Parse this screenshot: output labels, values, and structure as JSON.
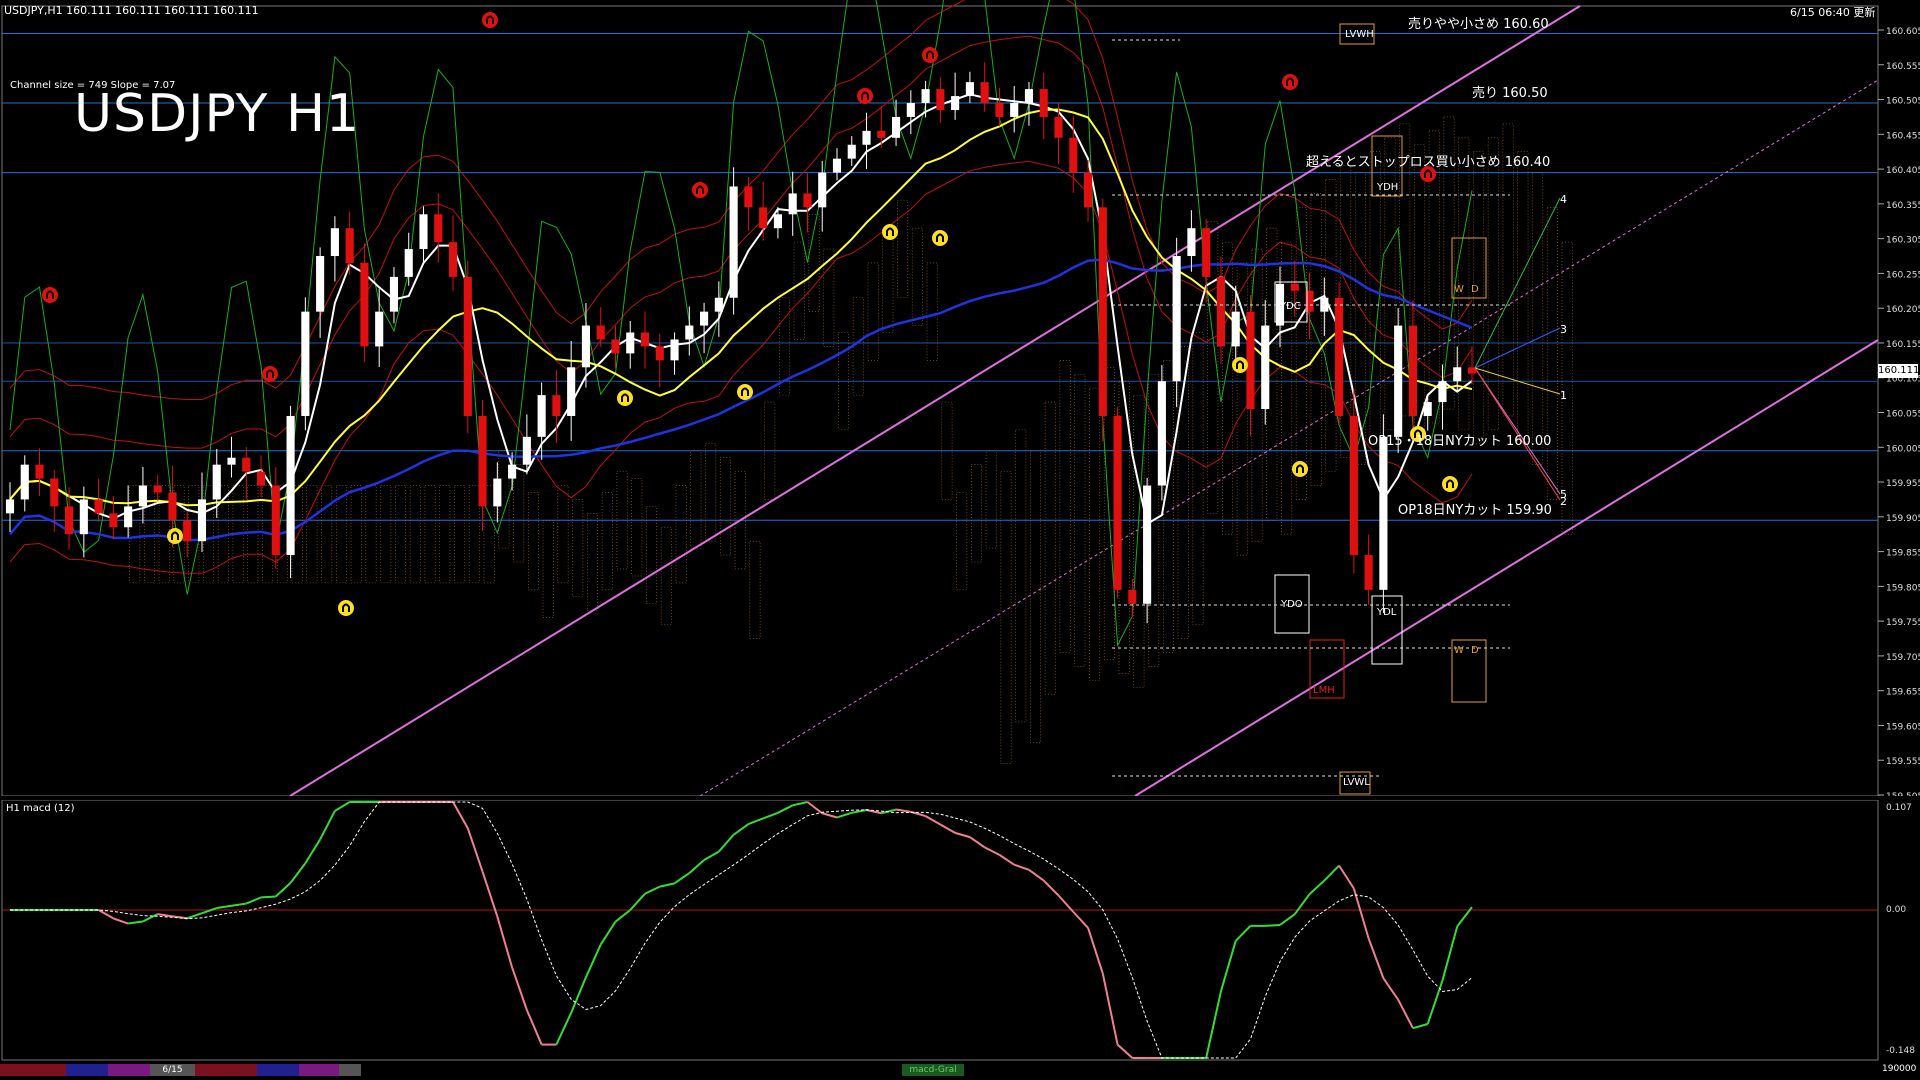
{
  "window": {
    "header_text": "USDJPY,H1  160.111 160.111 160.111 160.111",
    "timestamp": "6/15 06:40 更新"
  },
  "title": "USDJPY H1",
  "channel_info": "Channel size = 749 Slope = 7.07",
  "indicator_label": "H1  macd (12)",
  "current_price": "160.111",
  "price_axis": [
    "160.605",
    "160.555",
    "160.505",
    "160.455",
    "160.405",
    "160.355",
    "160.305",
    "160.255",
    "160.205",
    "160.155",
    "160.105",
    "160.055",
    "160.005",
    "159.955",
    "159.905",
    "159.855",
    "159.805",
    "159.755",
    "159.705",
    "159.655",
    "159.605",
    "159.555",
    "159.505"
  ],
  "macd_axis": [
    "0.107",
    "0.00",
    "-0.148"
  ],
  "levels": [
    {
      "label": "売りやや小さめ 160.60",
      "price": 160.6
    },
    {
      "label": "売り 160.50",
      "price": 160.5
    },
    {
      "label": "超えるとストップロス買い小さめ 160.40",
      "price": 160.4
    },
    {
      "label": "OP15・18日NYカット 160.00",
      "price": 160.0
    },
    {
      "label": "OP18日NYカット 159.90",
      "price": 159.9
    }
  ],
  "box_labels": {
    "lvwh": "LVWH",
    "ydh": "YDH",
    "ydc": "YDC",
    "ydo": "YDO",
    "ydl": "YDL",
    "lmh": "LMH",
    "lvwl": "LVWL",
    "w": "W",
    "d": "D",
    "w2": "W",
    "d2": "D"
  },
  "projection_labels": [
    "4",
    "3",
    "1",
    "5",
    "2"
  ],
  "bottom_tab_date": "6/15",
  "bottom_right": "190000",
  "bottom_center": "macd-Gral",
  "colors": {
    "level_line": "#1e6fd9",
    "channel": "#e070e0",
    "ichimoku_cloud_up": "#c8783c",
    "ichimoku_cloud_down": "#2438c8",
    "ma_short": "#ffffff",
    "ma_mid": "#ffff33",
    "ma_long": "#2033e0",
    "bollinger": "#c01010",
    "green_line": "#18b018",
    "candle_up": "#ffffff",
    "candle_down": "#e01010",
    "macd_up": "#33dd33",
    "macd_down": "#f08090",
    "signal": "#ffffff"
  },
  "chart_data": {
    "type": "candlestick",
    "symbol": "USDJPY",
    "timeframe": "H1",
    "ylim": [
      159.505,
      160.605
    ],
    "candle_count": 100,
    "close_path": [
      159.93,
      159.98,
      159.96,
      159.92,
      159.88,
      159.93,
      159.91,
      159.89,
      159.92,
      159.95,
      159.94,
      159.9,
      159.87,
      159.93,
      159.98,
      159.99,
      159.97,
      159.95,
      159.85,
      160.05,
      160.2,
      160.28,
      160.32,
      160.27,
      160.15,
      160.2,
      160.25,
      160.29,
      160.34,
      160.3,
      160.25,
      160.05,
      159.92,
      159.96,
      159.98,
      160.02,
      160.08,
      160.05,
      160.12,
      160.18,
      160.16,
      160.14,
      160.17,
      160.15,
      160.13,
      160.16,
      160.18,
      160.2,
      160.22,
      160.38,
      160.35,
      160.32,
      160.34,
      160.37,
      160.35,
      160.4,
      160.42,
      160.44,
      160.46,
      160.45,
      160.48,
      160.5,
      160.52,
      160.49,
      160.51,
      160.53,
      160.5,
      160.48,
      160.5,
      160.52,
      160.48,
      160.45,
      160.4,
      160.35,
      160.05,
      159.8,
      159.78,
      159.95,
      160.1,
      160.28,
      160.32,
      160.25,
      160.15,
      160.2,
      160.06,
      160.18,
      160.24,
      160.23,
      160.2,
      160.22,
      160.05,
      159.85,
      159.8,
      160.02,
      160.18,
      160.05,
      160.07,
      160.1,
      160.12,
      160.111
    ],
    "macd": {
      "values_hint": "oscillator",
      "ylim": [
        -0.148,
        0.107
      ]
    }
  }
}
